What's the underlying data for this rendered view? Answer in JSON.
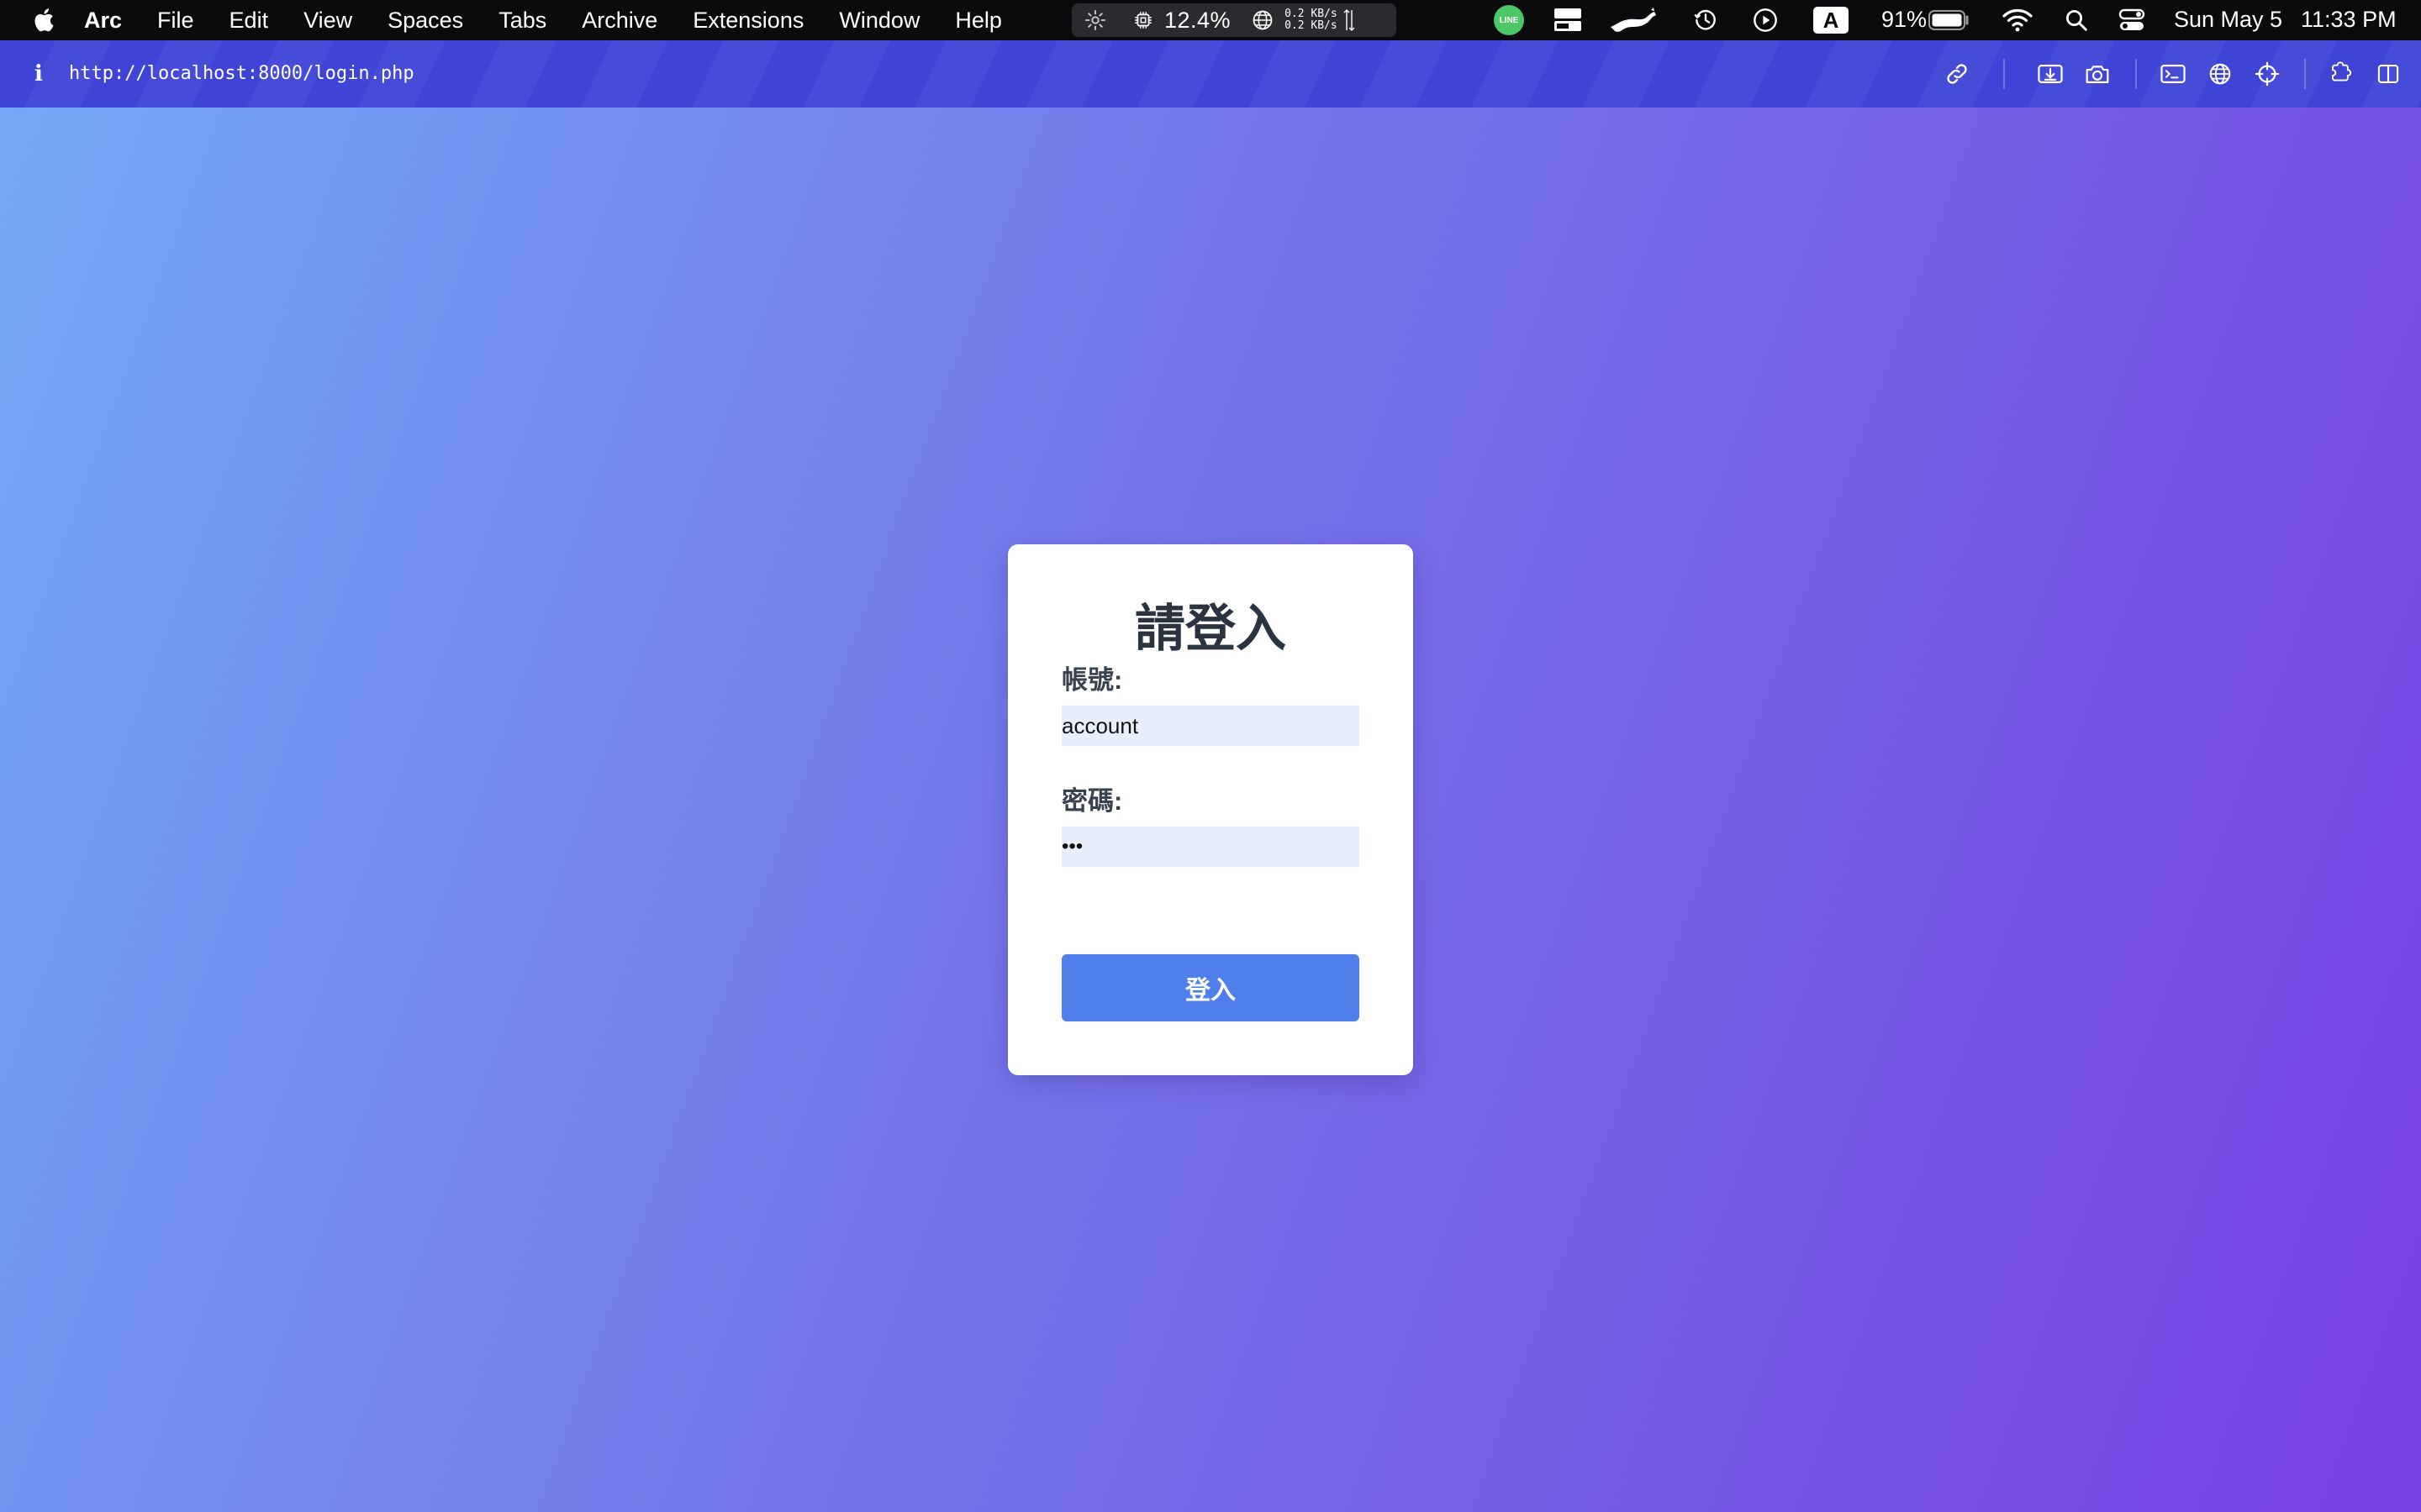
{
  "menubar": {
    "app_name": "Arc",
    "menus": [
      "File",
      "Edit",
      "View",
      "Spaces",
      "Tabs",
      "Archive",
      "Extensions",
      "Window",
      "Help"
    ],
    "cpu_usage": "12.4%",
    "net_up": "0.2 KB/s",
    "net_down": "0.2 KB/s",
    "line_badge": "LINE",
    "input_source": "A",
    "battery_percent": "91%",
    "date": "Sun May 5",
    "time": "11:33 PM"
  },
  "toolbar": {
    "url": "http://localhost:8000/login.php",
    "info_glyph": "i"
  },
  "login": {
    "title": "請登入",
    "account_label": "帳號:",
    "account_value": "account",
    "password_label": "密碼:",
    "password_masked": "•••",
    "submit_label": "登入"
  },
  "colors": {
    "menubar_bg": "#0b0b0d",
    "toolbar_bg": "#3f44d6",
    "page_gradient_start": "#74a7f5",
    "page_gradient_end": "#7640e3",
    "input_bg": "#e8effc",
    "button_bg": "#4f7feb"
  }
}
